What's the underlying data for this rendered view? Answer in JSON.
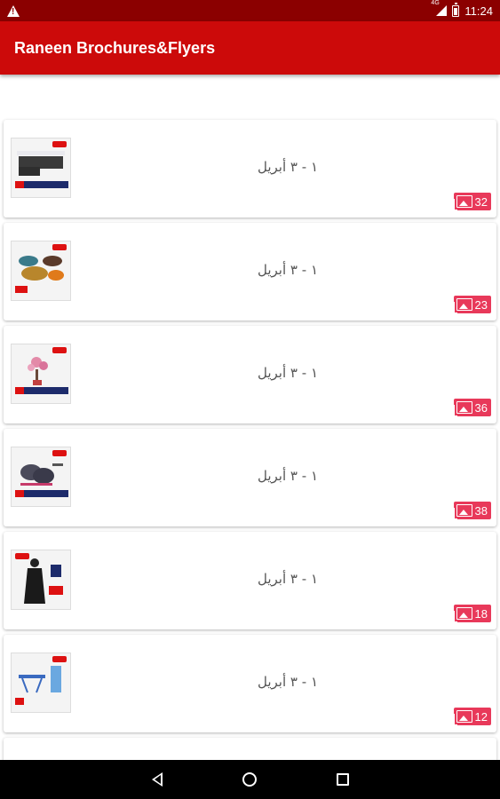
{
  "status_bar": {
    "time": "11:24",
    "network": "4G",
    "icons": [
      "warning-icon",
      "signal-icon",
      "battery-icon"
    ]
  },
  "app_bar": {
    "title": "Raneen Brochures&Flyers",
    "color": "#cc0a0a"
  },
  "brochures": [
    {
      "date": "١ - ٣ أبريل",
      "count": "32",
      "thumb": "sofa"
    },
    {
      "date": "١ - ٣ أبريل",
      "count": "23",
      "thumb": "bags"
    },
    {
      "date": "١ - ٣ أبريل",
      "count": "36",
      "thumb": "flower-vase"
    },
    {
      "date": "١ - ٣ أبريل",
      "count": "38",
      "thumb": "pans"
    },
    {
      "date": "١ - ٣ أبريل",
      "count": "18",
      "thumb": "abaya"
    },
    {
      "date": "١ - ٣ أبريل",
      "count": "12",
      "thumb": "kids-table"
    }
  ],
  "badge_color": "#e8395a",
  "nav_bar": {
    "icons": [
      "back-icon",
      "home-icon",
      "recents-icon"
    ]
  }
}
